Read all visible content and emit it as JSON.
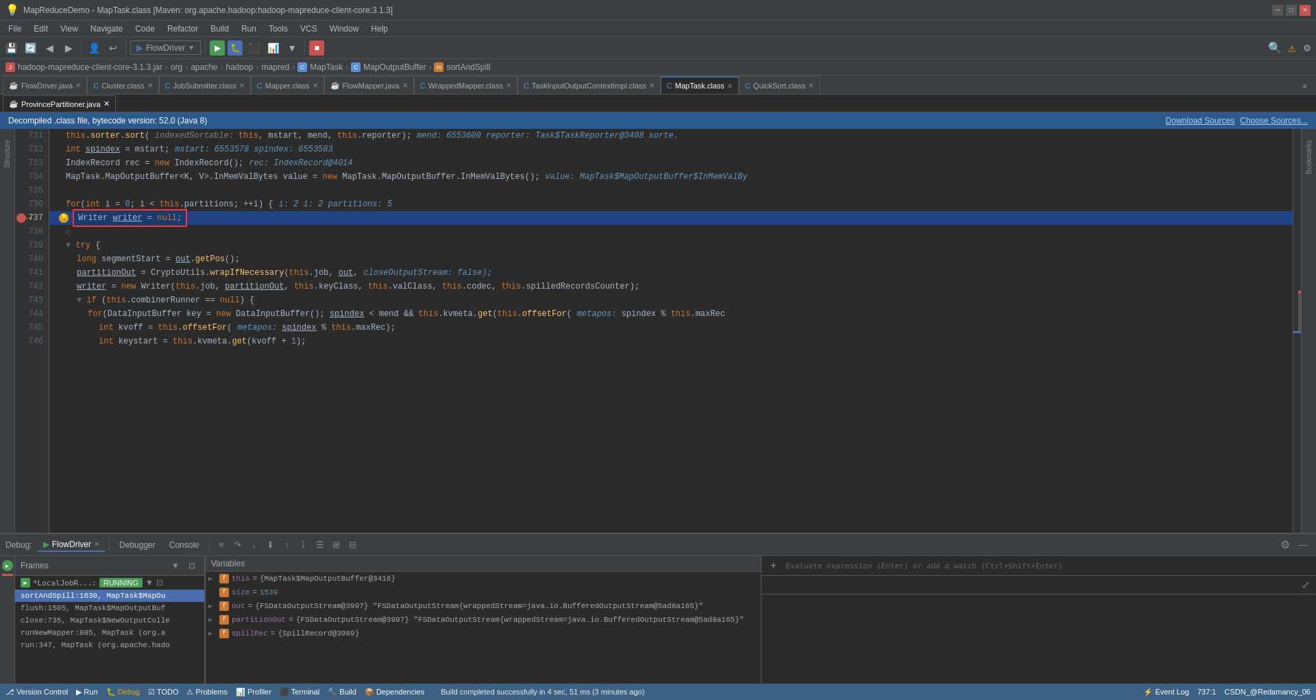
{
  "window": {
    "title": "MapReduceDemo - MapTask.class [Maven: org.apache.hadoop:hadoop-mapreduce-client-core:3.1.3]",
    "controls": [
      "minimize",
      "maximize",
      "close"
    ]
  },
  "menu": {
    "items": [
      "File",
      "Edit",
      "View",
      "Navigate",
      "Code",
      "Refactor",
      "Build",
      "Run",
      "Tools",
      "VCS",
      "Window",
      "Help"
    ]
  },
  "toolbar": {
    "run_config": "FlowDriver",
    "buttons": [
      "save",
      "open",
      "undo",
      "redo",
      "run",
      "debug",
      "stop"
    ]
  },
  "breadcrumb": {
    "items": [
      "hadoop-mapreduce-client-core-3.1.3.jar",
      "org",
      "apache",
      "hadoop",
      "mapred",
      "MapTask",
      "MapOutputBuffer",
      "sortAndSpill"
    ]
  },
  "tabs": [
    {
      "label": "FlowDriver.java",
      "icon": "java",
      "active": false
    },
    {
      "label": "Cluster.class",
      "icon": "class",
      "active": false
    },
    {
      "label": "JobSubmitter.class",
      "icon": "class",
      "active": false
    },
    {
      "label": "Mapper.class",
      "icon": "class",
      "active": false
    },
    {
      "label": "FlowMapper.java",
      "icon": "java",
      "active": false
    },
    {
      "label": "WrappedMapper.class",
      "icon": "class",
      "active": false
    },
    {
      "label": "TaskInputOutputContextImpl.class",
      "icon": "class",
      "active": false
    },
    {
      "label": "MapTask.class",
      "icon": "class",
      "active": true
    },
    {
      "label": "QuickSort.class",
      "icon": "class",
      "active": false
    }
  ],
  "sub_tab": {
    "label": "ProvincePartitioner.java",
    "active": true
  },
  "info_bar": {
    "text": "Decompiled .class file, bytecode version: 52.0 (Java 8)",
    "download_sources": "Download Sources",
    "choose_sources": "Choose Sources..."
  },
  "code": {
    "lines": [
      {
        "num": 731,
        "has_breakpoint": false,
        "content": "    this.sorter.sort( indexedSortable: this, mstart, mend, this.reporter);  mend: 6553600  reporter: Task$TaskReporter@3408  sorte.",
        "type": "normal"
      },
      {
        "num": 732,
        "has_breakpoint": false,
        "content": "    int spindex = mstart;  mstart: 6553578  spindex: 6553583",
        "type": "normal"
      },
      {
        "num": 733,
        "has_breakpoint": false,
        "content": "    IndexRecord rec = new IndexRecord();  rec: IndexRecord@4014",
        "type": "normal"
      },
      {
        "num": 734,
        "has_breakpoint": false,
        "content": "    MapTask.MapOutputBuffer<K, V>.InMemValBytes value = new MapTask.MapOutputBuffer.InMemValBytes();  value: MapTask$MapOutputBuffer$InMemValBy",
        "type": "normal"
      },
      {
        "num": 735,
        "has_breakpoint": false,
        "content": "",
        "type": "normal"
      },
      {
        "num": 736,
        "has_breakpoint": false,
        "content": "    for(int i = 0; i < this.partitions; ++i) {  i: 2  i: 2  partitions: 5",
        "type": "normal"
      },
      {
        "num": 737,
        "has_breakpoint": true,
        "content": "        Writer writer = null;",
        "type": "highlighted",
        "has_arrow": true
      },
      {
        "num": 738,
        "has_breakpoint": false,
        "content": "",
        "type": "normal"
      },
      {
        "num": 739,
        "has_breakpoint": false,
        "content": "    try {",
        "type": "normal",
        "has_fold": true
      },
      {
        "num": 740,
        "has_breakpoint": false,
        "content": "        long segmentStart = out.getPos();",
        "type": "normal"
      },
      {
        "num": 741,
        "has_breakpoint": false,
        "content": "        partitionOut = CryptoUtils.wrapIfNecessary(this.job, out,  closeOutputStream: false);",
        "type": "normal"
      },
      {
        "num": 742,
        "has_breakpoint": false,
        "content": "        writer = new Writer(this.job, partitionOut, this.keyClass, this.valClass, this.codec, this.spilledRecordsCounter);",
        "type": "normal"
      },
      {
        "num": 743,
        "has_breakpoint": false,
        "content": "        if (this.combinerRunner == null) {",
        "type": "normal",
        "has_fold": true
      },
      {
        "num": 744,
        "has_breakpoint": false,
        "content": "            for(DataInputBuffer key = new DataInputBuffer(); spindex < mend && this.kvmeta.get(this.offsetFor( metapos: spindex % this.maxRec",
        "type": "normal"
      },
      {
        "num": 745,
        "has_breakpoint": false,
        "content": "                int kvoff = this.offsetFor( metapos: spindex % this.maxRec);",
        "type": "normal"
      },
      {
        "num": 746,
        "has_breakpoint": false,
        "content": "                int keystart = this.kvmeta.get(kvoff + 1);",
        "type": "normal"
      }
    ]
  },
  "debug": {
    "tab_label": "Debug:",
    "session_name": "FlowDriver",
    "tabs": [
      "Debugger",
      "Console"
    ],
    "sections": {
      "frames": {
        "label": "Frames",
        "thread": "*LocalJobR...: RUNNING",
        "items": [
          "sortAndSpill:1630, MapTask$MapOu",
          "flush:1505, MapTask$MapOutputBuf",
          "close:735, MapTask$NewOutputColle",
          "runNewMapper:805, MapTask (org.a",
          "run:347, MapTask (org.apache.hado"
        ]
      },
      "variables": {
        "label": "Variables",
        "items": [
          {
            "expand": true,
            "icon": "field",
            "name": "this",
            "value": "= {MapTask$MapOutputBuffer@3416}"
          },
          {
            "expand": false,
            "icon": "field",
            "name": "size",
            "value": "= 1539"
          },
          {
            "expand": true,
            "icon": "field",
            "name": "out",
            "value": "= {FSDataOutputStream@3997} \"FSDataOutputStream{wrappedStream=java.io.BufferedOutputStream@5ad8a165}\""
          },
          {
            "expand": true,
            "icon": "field",
            "name": "partitionOut",
            "value": "= {FSDataOutputStream@3997} \"FSDataOutputStream{wrappedStream=java.io.BufferedOutputStream@5ad8a165}\""
          },
          {
            "expand": true,
            "icon": "field",
            "name": "spillRec",
            "value": "= {SpillRecord@3989}"
          }
        ]
      }
    },
    "watch": {
      "placeholder": "Evaluate expression (Enter) or add a watch (Ctrl+Shift+Enter)"
    }
  },
  "status_bar": {
    "left_items": [
      "Version Control",
      "Run",
      "Debug",
      "TODO",
      "Problems",
      "Profiler",
      "Terminal",
      "Build",
      "Dependencies"
    ],
    "message": "Build completed successfully in 4 sec, 51 ms (3 minutes ago)",
    "right_items": [
      "Event Log",
      "737:1",
      "CSDN_@Redamancy_06"
    ]
  },
  "icons": {
    "java_file": "☕",
    "class_file": "C",
    "breakpoint": "●",
    "arrow": "→",
    "fold": "▼",
    "collapse": "▶",
    "run": "▶",
    "debug": "🐛",
    "stop": "■",
    "resume": "▶",
    "step_over": "↷",
    "step_into": "↓",
    "step_out": "↑",
    "mute": "○",
    "filter": "⊡",
    "settings": "⚙",
    "plus": "+",
    "minus": "−",
    "expand": "▶",
    "expanded": "▼"
  },
  "colors": {
    "accent": "#4b6eaf",
    "breakpoint_red": "#c75450",
    "highlighted_line": "#214283",
    "debug_green": "#499c54",
    "warning_yellow": "#f0a30a",
    "background": "#2b2b2b",
    "panel_bg": "#3c3f41"
  }
}
